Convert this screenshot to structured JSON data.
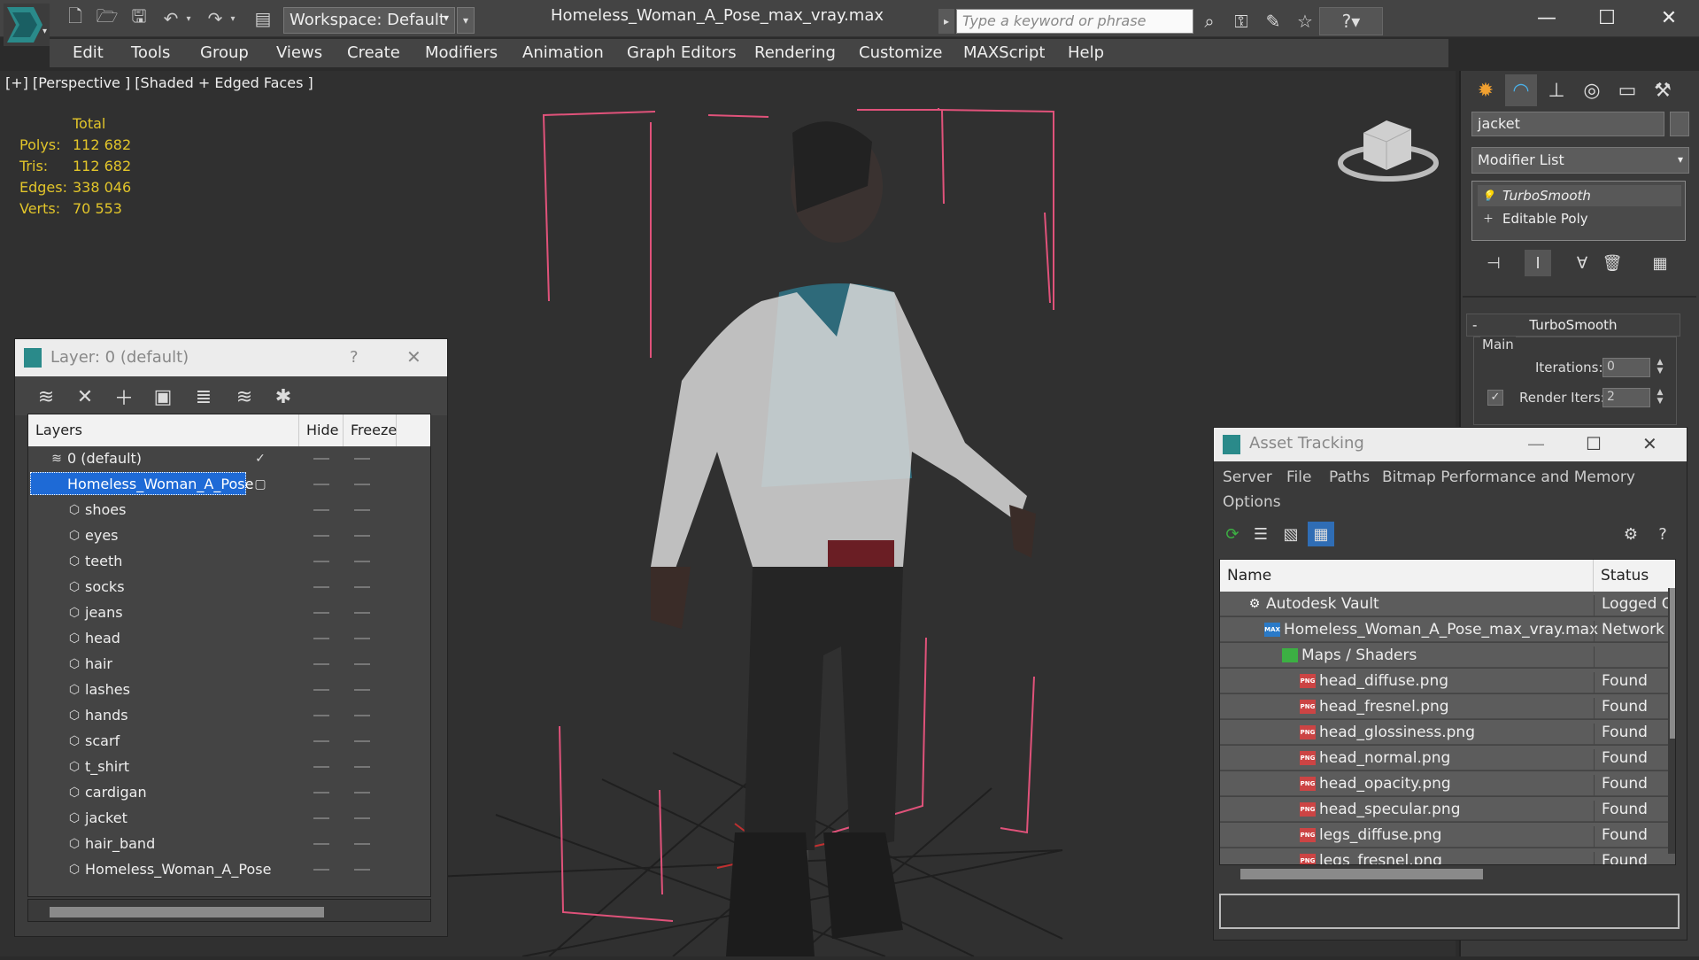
{
  "titlebar": {
    "workspace": "Workspace: Default",
    "window_title": "Homeless_Woman_A_Pose_max_vray.max",
    "search_placeholder": "Type a keyword or phrase",
    "min": "—",
    "max": "☐",
    "close": "✕"
  },
  "menu": [
    "Edit",
    "Tools",
    "Group",
    "Views",
    "Create",
    "Modifiers",
    "Animation",
    "Graph Editors",
    "Rendering",
    "Customize",
    "MAXScript",
    "Help"
  ],
  "viewport": {
    "label": "[+] [Perspective ] [Shaded + Edged Faces ]",
    "stats_header": "Total",
    "stats": [
      {
        "label": "Polys:",
        "value": "112 682"
      },
      {
        "label": "Tris:",
        "value": "112 682"
      },
      {
        "label": "Edges:",
        "value": "338 046"
      },
      {
        "label": "Verts:",
        "value": "70 553"
      }
    ]
  },
  "command_panel": {
    "object_name": "jacket",
    "modifier_list": "Modifier List",
    "stack": [
      "TurboSmooth",
      "Editable Poly"
    ],
    "rollout_title": "TurboSmooth",
    "group_main": "Main",
    "iterations_label": "Iterations:",
    "iterations_value": "0",
    "render_iters_label": "Render Iters:",
    "render_iters_value": "2"
  },
  "layer_dialog": {
    "title": "Layer: 0 (default)",
    "help": "?",
    "close": "✕",
    "columns": [
      "Layers",
      "Hide",
      "Freeze"
    ],
    "rows": [
      {
        "name": "0 (default)",
        "level": 0,
        "selected": false,
        "current": true
      },
      {
        "name": "Homeless_Woman_A_Pose",
        "level": 0,
        "selected": true,
        "current": false
      },
      {
        "name": "shoes",
        "level": 1
      },
      {
        "name": "eyes",
        "level": 1
      },
      {
        "name": "teeth",
        "level": 1
      },
      {
        "name": "socks",
        "level": 1
      },
      {
        "name": "jeans",
        "level": 1
      },
      {
        "name": "head",
        "level": 1
      },
      {
        "name": "hair",
        "level": 1
      },
      {
        "name": "lashes",
        "level": 1
      },
      {
        "name": "hands",
        "level": 1
      },
      {
        "name": "scarf",
        "level": 1
      },
      {
        "name": "t_shirt",
        "level": 1
      },
      {
        "name": "cardigan",
        "level": 1
      },
      {
        "name": "jacket",
        "level": 1
      },
      {
        "name": "hair_band",
        "level": 1
      },
      {
        "name": "Homeless_Woman_A_Pose",
        "level": 1
      }
    ]
  },
  "asset_tracking": {
    "title": "Asset Tracking",
    "menu": [
      "Server",
      "File",
      "Paths",
      "Bitmap Performance and Memory",
      "Options"
    ],
    "columns": [
      "Name",
      "Status"
    ],
    "rows": [
      {
        "name": "Autodesk Vault",
        "status": "Logged O",
        "level": 0,
        "icon": "vault"
      },
      {
        "name": "Homeless_Woman_A_Pose_max_vray.max",
        "status": "Network",
        "level": 1,
        "icon": "max"
      },
      {
        "name": "Maps / Shaders",
        "status": "",
        "level": 2,
        "icon": "maps"
      },
      {
        "name": "head_diffuse.png",
        "status": "Found",
        "level": 3,
        "icon": "png"
      },
      {
        "name": "head_fresnel.png",
        "status": "Found",
        "level": 3,
        "icon": "png"
      },
      {
        "name": "head_glossiness.png",
        "status": "Found",
        "level": 3,
        "icon": "png"
      },
      {
        "name": "head_normal.png",
        "status": "Found",
        "level": 3,
        "icon": "png"
      },
      {
        "name": "head_opacity.png",
        "status": "Found",
        "level": 3,
        "icon": "png"
      },
      {
        "name": "head_specular.png",
        "status": "Found",
        "level": 3,
        "icon": "png"
      },
      {
        "name": "legs_diffuse.png",
        "status": "Found",
        "level": 3,
        "icon": "png"
      },
      {
        "name": "legs_fresnel.png",
        "status": "Found",
        "level": 3,
        "icon": "png"
      }
    ]
  },
  "colors": {
    "stats": "#e2c52a",
    "selection": "#1e6ad6",
    "bbox": "#e0527a"
  }
}
